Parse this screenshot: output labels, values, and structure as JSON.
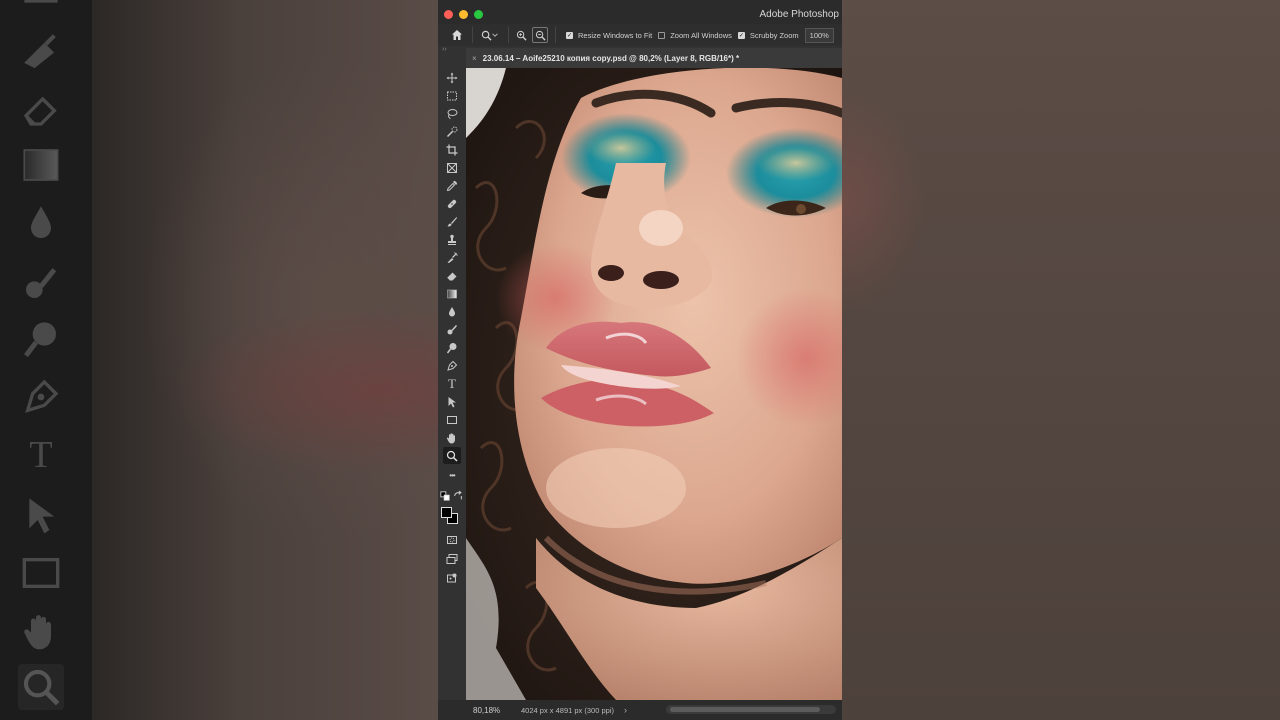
{
  "window": {
    "app_title": "Adobe Photoshop"
  },
  "options_bar": {
    "home_icon": "home-icon",
    "tool_icon": "zoom-tool-icon",
    "zoom_in_icon": "zoom-in-icon",
    "zoom_out_icon": "zoom-out-icon",
    "resize_windows_label": "Resize Windows to Fit",
    "resize_windows_checked": true,
    "zoom_all_label": "Zoom All Windows",
    "zoom_all_checked": false,
    "scrubby_label": "Scrubby Zoom",
    "scrubby_checked": true,
    "zoom_100_label": "100%"
  },
  "document": {
    "tab_title": "23.06.14 – Aoife25210 копия copy.psd @ 80,2% (Layer 8, RGB/16*) *",
    "close_glyph": "×"
  },
  "toolbar": {
    "expand_glyph": "››",
    "tools": [
      "move-tool-icon",
      "marquee-tool-icon",
      "lasso-tool-icon",
      "quick-select-tool-icon",
      "crop-tool-icon",
      "frame-tool-icon",
      "eyedropper-tool-icon",
      "healing-brush-icon",
      "brush-tool-icon",
      "clone-stamp-icon",
      "history-brush-icon",
      "eraser-tool-icon",
      "gradient-tool-icon",
      "blur-tool-icon",
      "dodge-tool-icon",
      "dodge-burn-icon",
      "pen-tool-icon",
      "type-tool-icon",
      "path-select-icon",
      "rectangle-tool-icon",
      "hand-tool-icon",
      "zoom-tool-icon",
      "more-tools-icon"
    ],
    "active_tool": "zoom-tool-icon",
    "type_glyph": "T",
    "more_glyph": "•••",
    "foreground_color": "#000000",
    "background_color": "#000000"
  },
  "status_bar": {
    "zoom": "80,18%",
    "doc_info": "4024 px x 4891 px (300 ppi)",
    "arrow": "›"
  },
  "background_toolbar": {
    "type_glyph": "T"
  }
}
